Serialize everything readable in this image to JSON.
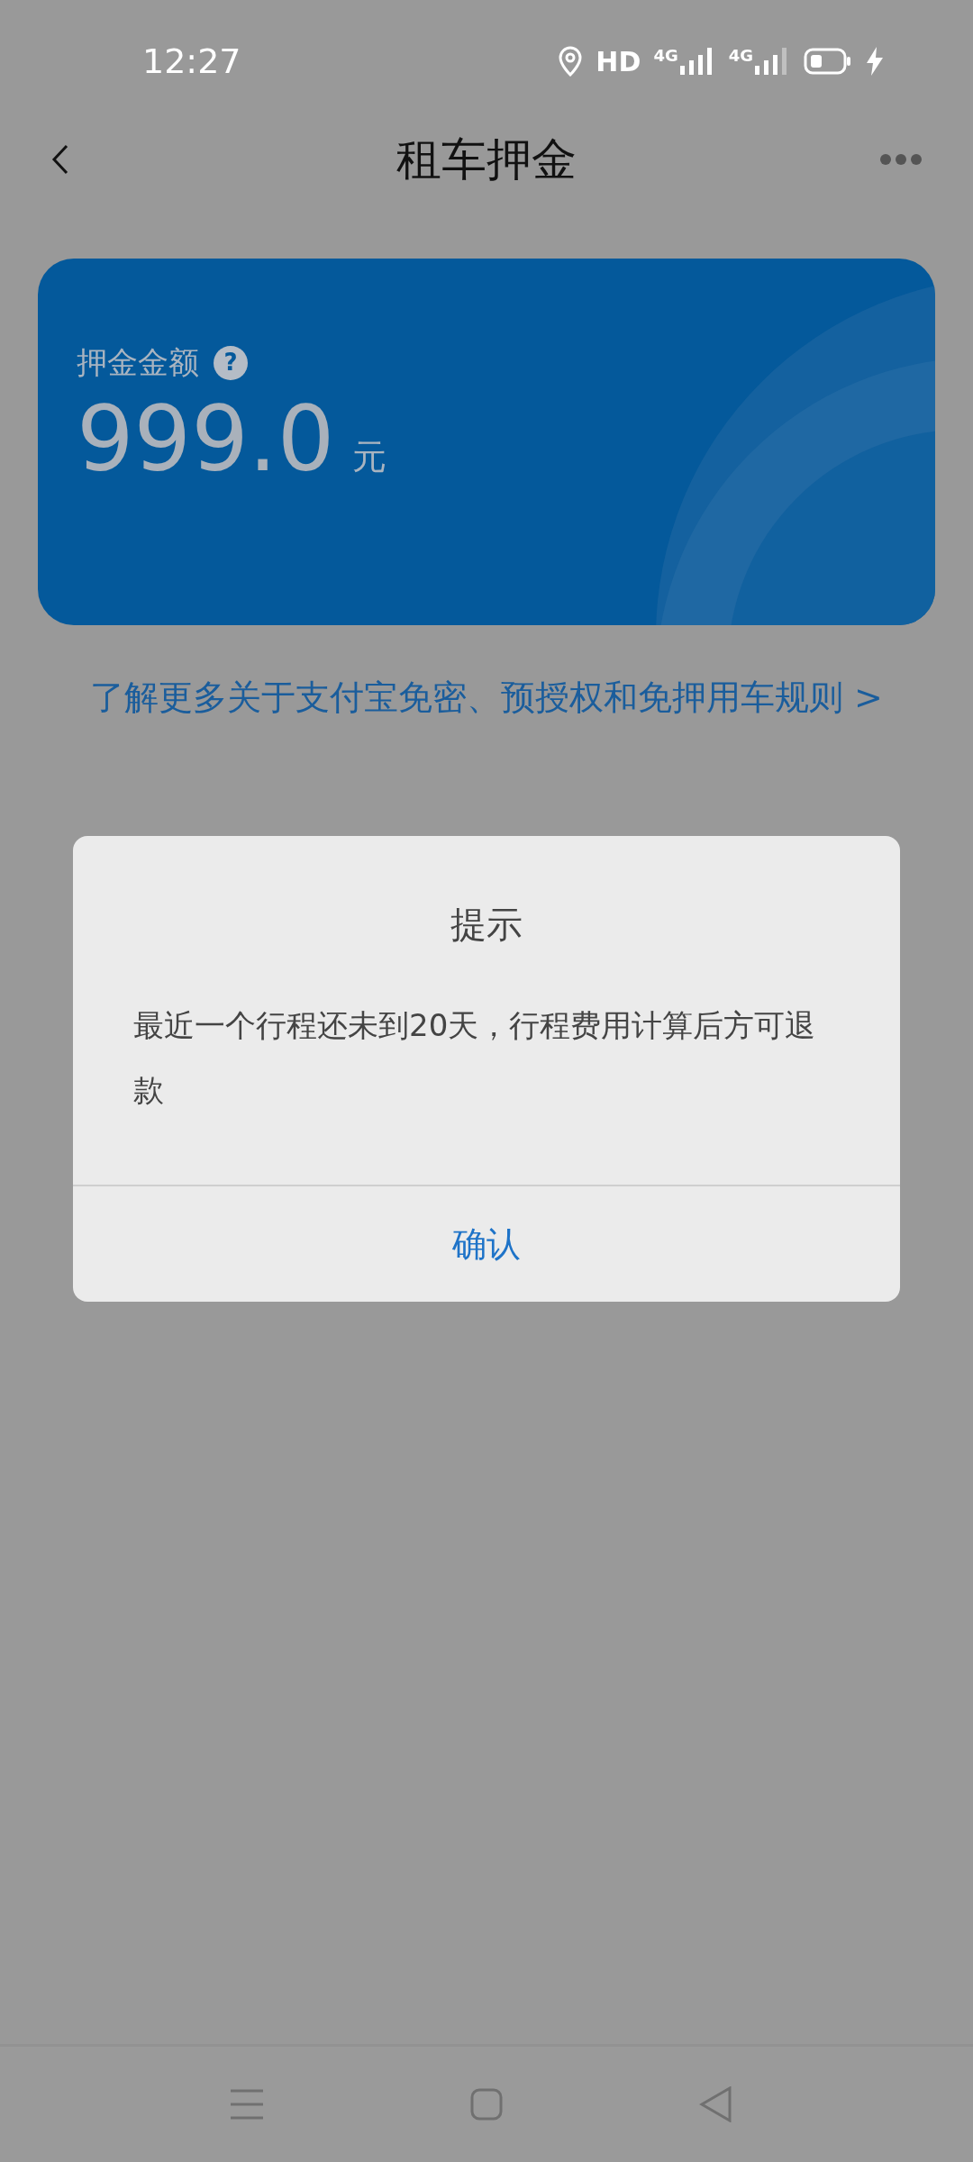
{
  "status_bar": {
    "time": "12:27",
    "hd_label": "HD",
    "sim_1_label": "4G",
    "sim_2_label": "4G"
  },
  "header": {
    "title": "租车押金"
  },
  "deposit_card": {
    "label": "押金金额",
    "help_icon": "?",
    "amount": "999.0",
    "unit": "元"
  },
  "rules_link": "了解更多关于支付宝免密、预授权和免押用车规则 >",
  "dialog": {
    "title": "提示",
    "message": "最近一个行程还未到20天，行程费用计算后方可退款",
    "confirm_button": "确认"
  }
}
